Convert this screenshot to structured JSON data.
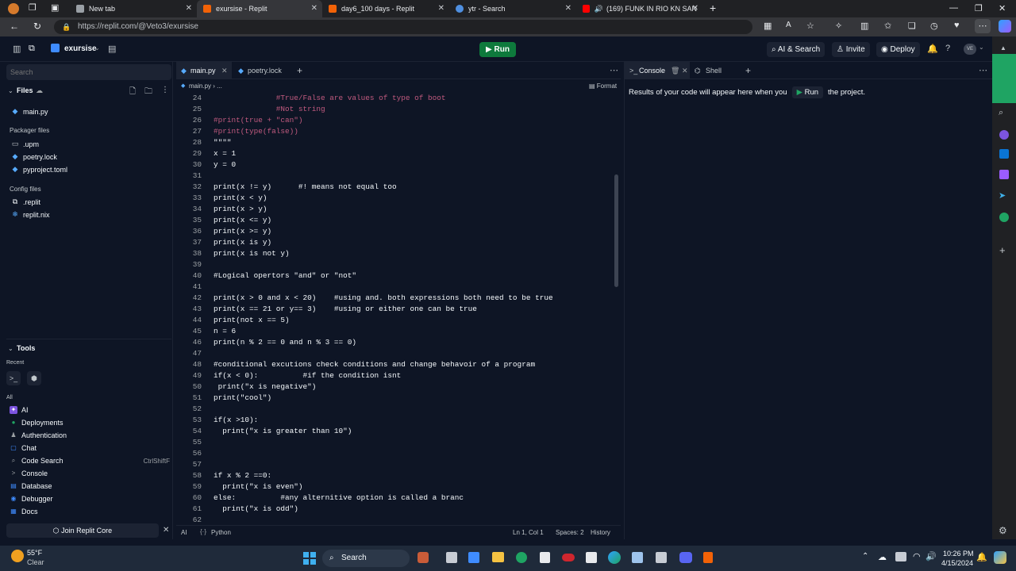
{
  "browser": {
    "tabs": [
      {
        "label": "New tab",
        "fav_color": "#9aa0a6"
      },
      {
        "label": "exursise - Replit",
        "fav_color": "#f26207"
      },
      {
        "label": "day6_100 days - Replit",
        "fav_color": "#f26207"
      },
      {
        "label": "ytr - Search",
        "fav_color": "#4f8fe0"
      },
      {
        "label": "(169) FUNK IN RIO KN SAN",
        "fav_color": "#ff0000"
      }
    ],
    "url": "https://replit.com/@Veto3/exursise"
  },
  "topbar": {
    "repl_name": "exursise",
    "run_label": "Run",
    "ai_search_label": "AI & Search",
    "invite_label": "Invite",
    "deploy_label": "Deploy",
    "avatar_initials": "VE"
  },
  "sidebar": {
    "search_placeholder": "Search",
    "files_label": "Files",
    "files": [
      {
        "name": "main.py",
        "icon": "python-icon"
      }
    ],
    "packager_label": "Packager files",
    "packager_files": [
      {
        "name": ".upm",
        "icon": "folder-icon"
      },
      {
        "name": "poetry.lock",
        "icon": "lock-icon"
      },
      {
        "name": "pyproject.toml",
        "icon": "toml-icon"
      }
    ],
    "config_label": "Config files",
    "config_files": [
      {
        "name": ".replit",
        "icon": "replit-icon"
      },
      {
        "name": "replit.nix",
        "icon": "nix-icon"
      }
    ],
    "tools_label": "Tools",
    "recent_label": "Recent",
    "all_label": "All",
    "tools": [
      {
        "name": "AI",
        "color": "#7c54e0",
        "glyph": "✦"
      },
      {
        "name": "Deployments",
        "color": "#1fa463",
        "glyph": "●"
      },
      {
        "name": "Authentication",
        "color": "#9da2a6",
        "glyph": "♟"
      },
      {
        "name": "Chat",
        "color": "#3f8cff",
        "glyph": "▢"
      },
      {
        "name": "Code Search",
        "color": "#9da2a6",
        "glyph": "⌕",
        "shortcut": "CtrlShiftF"
      },
      {
        "name": "Console",
        "color": "#9da2a6",
        "glyph": ">"
      },
      {
        "name": "Database",
        "color": "#3f8cff",
        "glyph": "▤"
      },
      {
        "name": "Debugger",
        "color": "#3f8cff",
        "glyph": "◉"
      },
      {
        "name": "Docs",
        "color": "#3f8cff",
        "glyph": "▦"
      }
    ],
    "join_core_label": "Join Replit Core"
  },
  "editor": {
    "tabs": [
      "main.py",
      "poetry.lock"
    ],
    "breadcrumb": "main.py › ...",
    "format_label": "Format",
    "lines": [
      {
        "n": "24",
        "t": "              #True/False are values of type of boot",
        "c": true
      },
      {
        "n": "25",
        "t": "              #Not string",
        "c": true
      },
      {
        "n": "26",
        "t": "#print(true + \"can\")",
        "c": true
      },
      {
        "n": "27",
        "t": "#print(type(false))",
        "c": true
      },
      {
        "n": "28",
        "t": "\"\"\"\"",
        "c": false
      },
      {
        "n": "29",
        "t": "x = 1",
        "c": false
      },
      {
        "n": "30",
        "t": "y = 0",
        "c": false
      },
      {
        "n": "31",
        "t": "",
        "c": false
      },
      {
        "n": "32",
        "t": "print(x != y)      #! means not equal too",
        "c": false
      },
      {
        "n": "33",
        "t": "print(x < y)",
        "c": false
      },
      {
        "n": "34",
        "t": "print(x > y)",
        "c": false
      },
      {
        "n": "35",
        "t": "print(x <= y)",
        "c": false
      },
      {
        "n": "36",
        "t": "print(x >= y)",
        "c": false
      },
      {
        "n": "37",
        "t": "print(x is y)",
        "c": false
      },
      {
        "n": "38",
        "t": "print(x is not y)",
        "c": false
      },
      {
        "n": "39",
        "t": "",
        "c": false
      },
      {
        "n": "40",
        "t": "#Logical opertors \"and\" or \"not\"",
        "c": false
      },
      {
        "n": "41",
        "t": "",
        "c": false
      },
      {
        "n": "42",
        "t": "print(x > 0 and x < 20)    #using and. both expressions both need to be true",
        "c": false
      },
      {
        "n": "43",
        "t": "print(x == 21 or y== 3)    #using or either one can be true",
        "c": false
      },
      {
        "n": "44",
        "t": "print(not x == 5)",
        "c": false
      },
      {
        "n": "45",
        "t": "n = 6",
        "c": false
      },
      {
        "n": "46",
        "t": "print(n % 2 == 0 and n % 3 == 0)",
        "c": false
      },
      {
        "n": "47",
        "t": "",
        "c": false
      },
      {
        "n": "48",
        "t": "#conditional excutions check conditions and change behavoir of a program",
        "c": false
      },
      {
        "n": "49",
        "t": "if(x < 0):          #if the condition isnt",
        "c": false
      },
      {
        "n": "50",
        "t": " print(\"x is negative\")",
        "c": false
      },
      {
        "n": "51",
        "t": "print(\"cool\")",
        "c": false
      },
      {
        "n": "52",
        "t": "",
        "c": false
      },
      {
        "n": "53",
        "t": "if(x >10):",
        "c": false
      },
      {
        "n": "54",
        "t": "  print(\"x is greater than 10\")",
        "c": false
      },
      {
        "n": "55",
        "t": "",
        "c": false
      },
      {
        "n": "56",
        "t": "",
        "c": false
      },
      {
        "n": "57",
        "t": "",
        "c": false
      },
      {
        "n": "58",
        "t": "if x % 2 ==0:",
        "c": false
      },
      {
        "n": "59",
        "t": "  print(\"x is even\")",
        "c": false
      },
      {
        "n": "60",
        "t": "else:          #any alternitive option is called a branc",
        "c": false
      },
      {
        "n": "61",
        "t": "  print(\"x is odd\")",
        "c": false
      },
      {
        "n": "62",
        "t": "",
        "c": false
      }
    ],
    "status": {
      "ai": "AI",
      "language": "Python",
      "position": "Ln 1, Col 1",
      "spaces": "Spaces: 2",
      "history": "History"
    }
  },
  "console": {
    "tabs": [
      "Console",
      "Shell"
    ],
    "message_before": "Results of your code will appear here when you",
    "run_label": "Run",
    "message_after": "the project."
  },
  "taskbar": {
    "weather_temp": "55°F",
    "weather_desc": "Clear",
    "search_label": "Search",
    "time": "10:26 PM",
    "date": "4/15/2024"
  }
}
